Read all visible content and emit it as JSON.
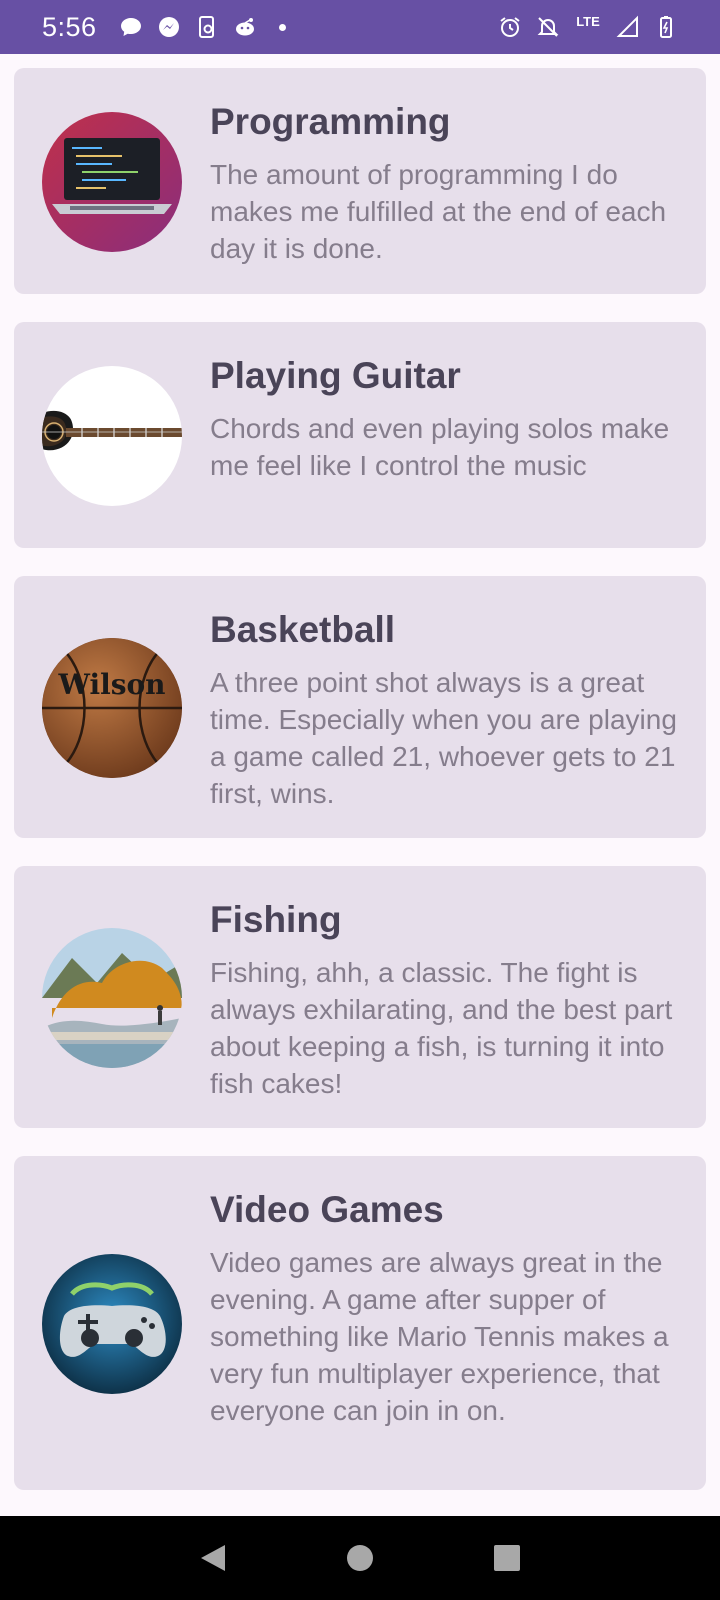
{
  "status_bar": {
    "time": "5:56",
    "network_label": "LTE",
    "left_icons": [
      "chat-bubble-icon",
      "messenger-icon",
      "phone-sync-icon",
      "reddit-icon",
      "notification-dot"
    ],
    "right_icons": [
      "alarm-icon",
      "notifications-off-icon",
      "lte-icon",
      "signal-icon",
      "battery-icon"
    ]
  },
  "colors": {
    "accent": "#6750a4",
    "card_background": "#e7dfeb",
    "title_text": "#4a4458",
    "body_text": "#857d8c",
    "page_background": "#fdf8fd"
  },
  "hobbies": [
    {
      "title": "Programming",
      "description": "The amount of programming I do makes me fulfilled at the end of each day it is done.",
      "image": "laptop-code-image"
    },
    {
      "title": "Playing Guitar",
      "description": "Chords and even playing solos make me feel like I control the music",
      "image": "guitar-image"
    },
    {
      "title": "Basketball",
      "description": "A three point shot always is a great time. Especially when you are playing a game called 21, whoever gets to 21 first, wins.",
      "image": "basketball-image"
    },
    {
      "title": "Fishing",
      "description": "Fishing, ahh, a classic. The fight is always exhilarating, and the best part about keeping a fish, is turning it into fish cakes!",
      "image": "fishing-landscape-image"
    },
    {
      "title": "Video Games",
      "description": "Video games are always great in the evening. A game after supper of something like Mario Tennis makes a very fun multiplayer experience, that everyone can join in on.",
      "image": "game-controller-image"
    }
  ],
  "nav_bar": {
    "buttons": [
      "back-icon",
      "home-icon",
      "recents-icon"
    ]
  }
}
